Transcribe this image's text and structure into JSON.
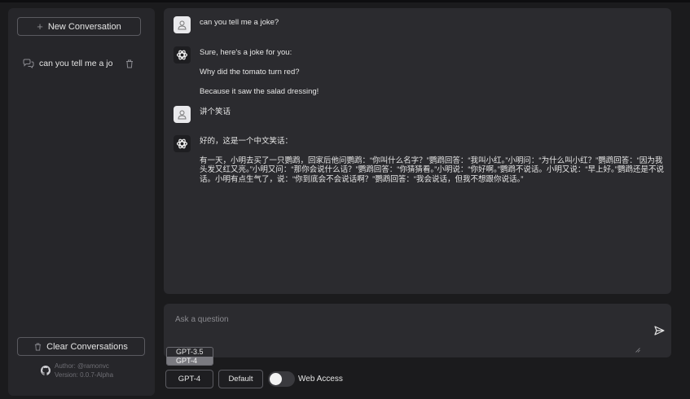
{
  "sidebar": {
    "new_conversation_label": "New Conversation",
    "conversations": [
      {
        "label": "can you tell me a jo"
      }
    ],
    "clear_label": "Clear Conversations",
    "author_line": "Author: @ramonvc",
    "version_line": "Version: 0.0.7-Alpha"
  },
  "chat": {
    "messages": [
      {
        "role": "user",
        "text": "can you tell me a joke?"
      },
      {
        "role": "assistant",
        "paragraphs": [
          "Sure, here's a joke for you:",
          "Why did the tomato turn red?",
          "Because it saw the salad dressing!"
        ]
      },
      {
        "role": "user",
        "text": "讲个笑话"
      },
      {
        "role": "assistant",
        "paragraphs": [
          "好的，这是一个中文笑话：",
          "有一天，小明去买了一只鹦鹉，回家后他问鹦鹉：“你叫什么名字？”鹦鹉回答：“我叫小红。”小明问：“为什么叫小红？”鹦鹉回答：“因为我头发又红又亮。”小明又问：“那你会说什么话？”鹦鹉回答：“你猜猜看。”小明说：“你好啊。”鹦鹉不说话。小明又说：“早上好。”鹦鹉还是不说话。小明有点生气了，说：“你到底会不会说话啊？”鹦鹉回答：“我会说话，但我不想跟你说话。”"
        ]
      }
    ]
  },
  "input": {
    "placeholder": "Ask a question"
  },
  "controls": {
    "model_options": [
      "GPT-3.5",
      "GPT-4"
    ],
    "model_selected": "GPT-4",
    "default_label": "Default",
    "web_access_label": "Web Access",
    "web_access_enabled": false
  },
  "colors": {
    "background": "#1b1b1d",
    "panel": "#2b2b2f",
    "sidebar": "#26262a",
    "border": "#5a5a60"
  }
}
